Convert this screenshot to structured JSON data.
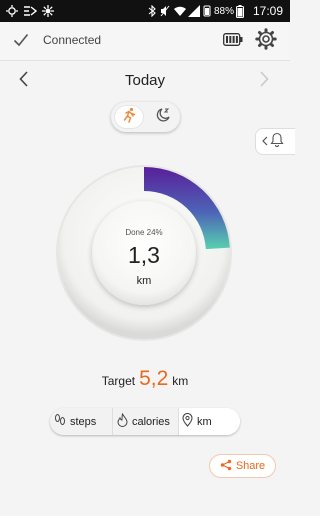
{
  "status_bar": {
    "battery_percent": "88%",
    "time": "17:09"
  },
  "topbar": {
    "connection_status": "Connected"
  },
  "date_nav": {
    "title": "Today"
  },
  "gauge": {
    "done_label": "Done 24%",
    "progress_fraction": 0.24,
    "value": "1,3",
    "unit": "km",
    "colors": {
      "start": "#5a1f9a",
      "end": "#57d1b0"
    }
  },
  "target": {
    "label": "Target",
    "value": "5,2",
    "unit": "km"
  },
  "metric_tabs": [
    {
      "label": "steps",
      "icon": "footprints-icon"
    },
    {
      "label": "calories",
      "icon": "flame-icon"
    },
    {
      "label": "km",
      "icon": "location-pin-icon",
      "selected": true
    }
  ],
  "share": {
    "label": "Share"
  },
  "colors": {
    "accent": "#e86a1c",
    "accent_orange": "#f08a3c"
  }
}
